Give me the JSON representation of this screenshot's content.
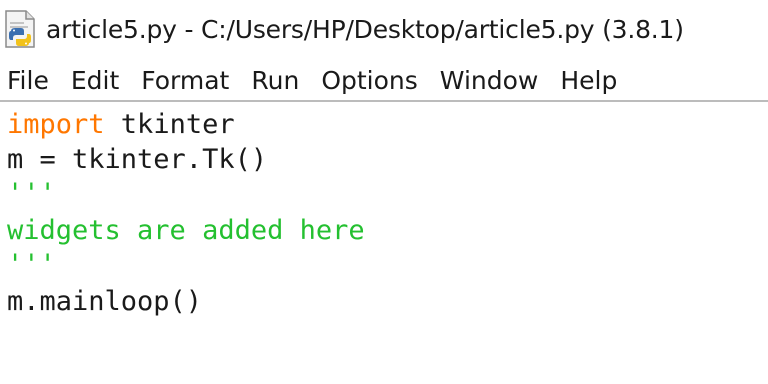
{
  "window": {
    "title": "article5.py - C:/Users/HP/Desktop/article5.py (3.8.1)",
    "icon": "python-file-icon"
  },
  "menu": {
    "items": [
      "File",
      "Edit",
      "Format",
      "Run",
      "Options",
      "Window",
      "Help"
    ]
  },
  "editor": {
    "lines": [
      {
        "keyword": "import",
        "rest": " tkinter"
      },
      {
        "text": "m = tkinter.Tk()"
      },
      {
        "string": "'''"
      },
      {
        "string": "widgets are added here"
      },
      {
        "string": "'''"
      },
      {
        "text": "m.mainloop()"
      }
    ]
  },
  "colors": {
    "keyword": "#ff7700",
    "string": "#24c030",
    "text": "#1a1a1a"
  }
}
